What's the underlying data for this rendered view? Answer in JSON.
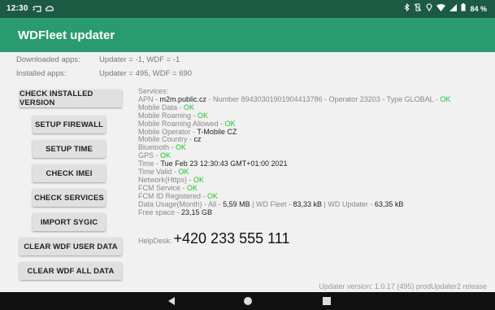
{
  "status": {
    "time": "12:30",
    "battery": "84 %",
    "icons": [
      "cast-icon",
      "bluetooth-icon",
      "vibrate-icon",
      "location-icon",
      "wifi-icon",
      "signal-icon",
      "battery-icon"
    ]
  },
  "app": {
    "title": "WDFleet updater"
  },
  "downloaded": {
    "label": "Downloaded apps:",
    "value": "Updater = -1, WDF = -1"
  },
  "installed": {
    "label": "Installed apps:",
    "value": "Updater = 495, WDF = 690"
  },
  "buttons": {
    "check_installed": "CHECK INSTALLED VERSION",
    "setup_firewall": "SETUP FIREWALL",
    "setup_time": "SETUP TIME",
    "check_imei": "CHECK IMEI",
    "check_services": "CHECK SERVICES",
    "import_sygic": "IMPORT SYGIC",
    "clear_user_data": "CLEAR WDF USER DATA",
    "clear_all_data": "CLEAR WDF ALL DATA"
  },
  "services": {
    "header": "Services:",
    "apn_label": "APN",
    "apn_value": "m2m.public.cz",
    "number_label": "Number",
    "number_value": "89430301901904413786",
    "operator_label": "Operator",
    "operator_value": "23203",
    "type_label": "Type",
    "type_value": "GLOBAL",
    "ok": "OK",
    "mobile_data": "Mobile Data",
    "mobile_roaming": "Mobile Roaming",
    "mobile_roaming_allowed": "Mobile Roaming Allowed",
    "mobile_operator": "Mobile Operator",
    "mobile_operator_value": "T-Mobile CZ",
    "mobile_country": "Mobile Country",
    "mobile_country_value": "cz",
    "bluetooth": "Bluetooth",
    "gps": "GPS",
    "time": "Time",
    "time_value": "Tue Feb 23 12:30:43 GMT+01:00 2021",
    "time_valid": "Time Valid",
    "network": "Network(Https)",
    "fcm_service": "FCM Service",
    "fcm_id": "FCM ID Registered",
    "usage_label": "Data Usage(Month)",
    "usage_all_label": "All",
    "usage_all": "5,59 MB",
    "usage_fleet_label": "WD Fleet",
    "usage_fleet": "83,33 kB",
    "usage_updater_label": "WD Updater",
    "usage_updater": "63,35 kB",
    "free_label": "Free space",
    "free_value": "23,15 GB"
  },
  "helpdesk": {
    "label": "HelpDesk:",
    "number": "+420 233 555 111"
  },
  "version": "Updater version: 1.0.17 (495) prodUpdater2 release",
  "colors": {
    "status_bar": "#1c5a43",
    "app_bar": "#2a9b6e",
    "ok_green": "#1ec62a",
    "nav_bar": "#111111"
  }
}
